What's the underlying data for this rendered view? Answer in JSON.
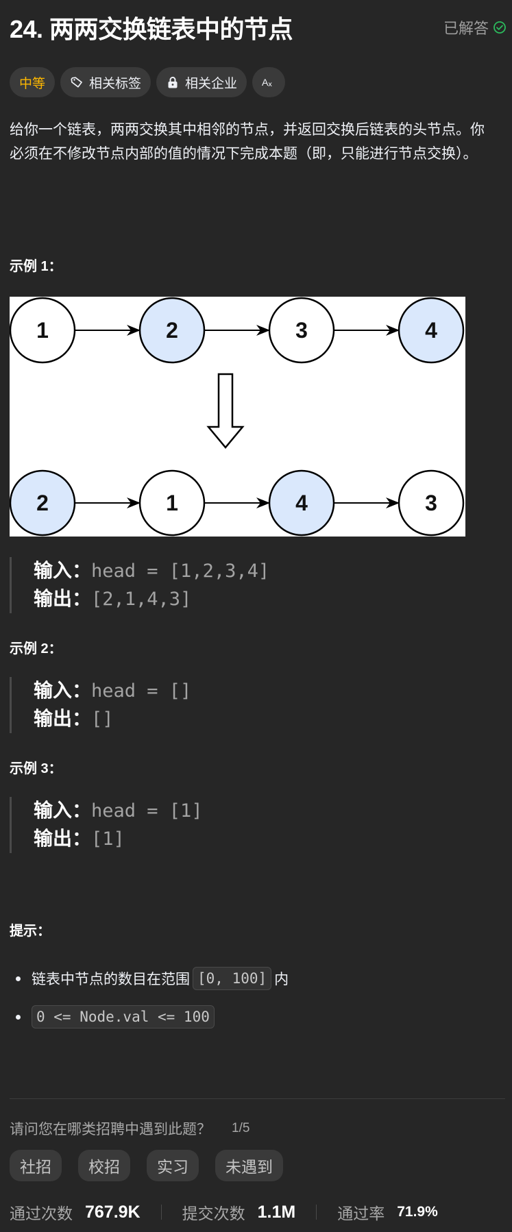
{
  "header": {
    "title": "24. 两两交换链表中的节点",
    "status": "已解答",
    "status_icon": "check-circle-icon",
    "status_color": "#2cbb5d"
  },
  "tags": [
    {
      "label": "中等",
      "icon": null,
      "color": "#ffb800"
    },
    {
      "label": "相关标签",
      "icon": "tag-icon"
    },
    {
      "label": "相关企业",
      "icon": "lock-icon"
    },
    {
      "label": "Aあ",
      "icon": "translate-icon"
    }
  ],
  "description": "给你一个链表，两两交换其中相邻的节点，并返回交换后链表的头节点。你必须在不修改节点内部的值的情况下完成本题（即，只能进行节点交换）。",
  "examples": [
    {
      "label": "示例 1：",
      "input_key": "输入：",
      "input": "head = [1,2,3,4]",
      "output_key": "输出：",
      "output": "[2,1,4,3]"
    },
    {
      "label": "示例 2：",
      "input_key": "输入：",
      "input": "head = []",
      "output_key": "输出：",
      "output": "[]"
    },
    {
      "label": "示例 3：",
      "input_key": "输入：",
      "input": "head = [1]",
      "output_key": "输出：",
      "output": "[1]"
    }
  ],
  "diagram": {
    "before": [
      {
        "value": "1",
        "highlighted": false
      },
      {
        "value": "2",
        "highlighted": true
      },
      {
        "value": "3",
        "highlighted": false
      },
      {
        "value": "4",
        "highlighted": true
      }
    ],
    "after": [
      {
        "value": "2",
        "highlighted": true
      },
      {
        "value": "1",
        "highlighted": false
      },
      {
        "value": "4",
        "highlighted": true
      },
      {
        "value": "3",
        "highlighted": false
      }
    ],
    "highlight_color": "#dae8fc"
  },
  "hints": {
    "label": "提示：",
    "items": [
      {
        "text": "链表中节点的数目在范围",
        "code": "[0, 100]",
        "suffix": "内"
      },
      {
        "text": "",
        "code": "0 <= Node.val <= 100",
        "suffix": ""
      }
    ]
  },
  "survey": {
    "question": "请问您在哪类招聘中遇到此题？",
    "count": "1/5",
    "options": [
      "社招",
      "校招",
      "实习",
      "未遇到"
    ]
  },
  "stats": {
    "accepted_label": "通过次数",
    "accepted_value": "767.9K",
    "submissions_label": "提交次数",
    "submissions_value": "1.1M",
    "rate_label": "通过率",
    "rate_value": "71.9%"
  }
}
